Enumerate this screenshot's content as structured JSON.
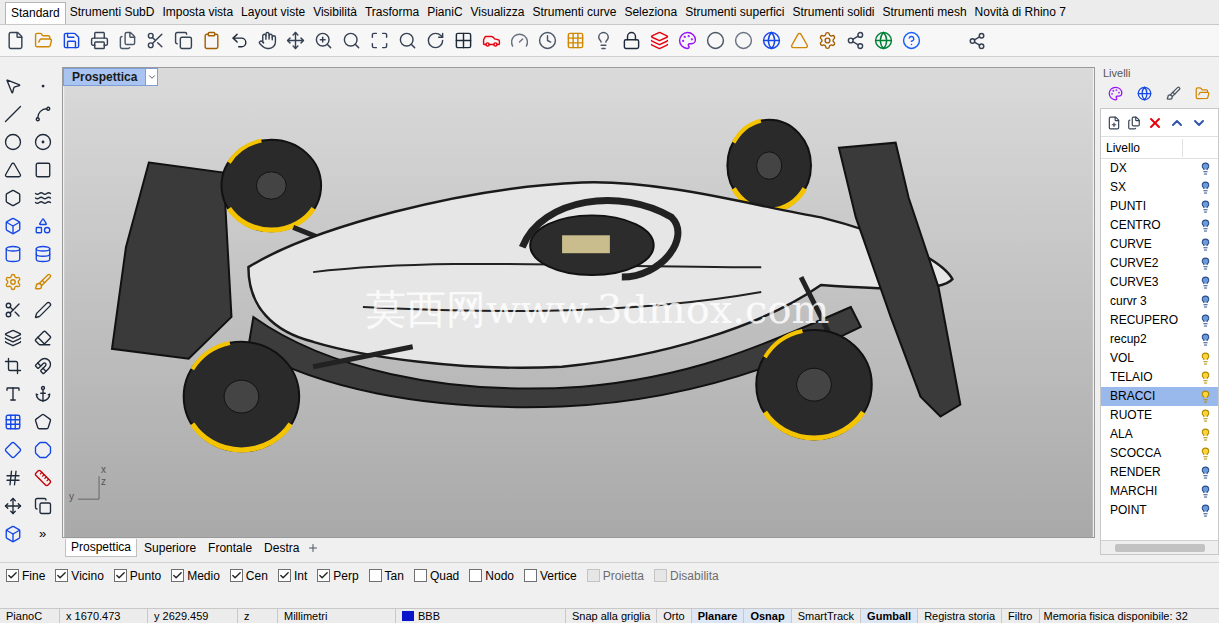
{
  "menu_tabs": [
    {
      "label": "Standard",
      "selected": true
    },
    {
      "label": "Strumenti SubD",
      "selected": false
    },
    {
      "label": "Imposta vista",
      "selected": false
    },
    {
      "label": "Layout viste",
      "selected": false
    },
    {
      "label": "Visibilità",
      "selected": false
    },
    {
      "label": "Trasforma",
      "selected": false
    },
    {
      "label": "PianiC",
      "selected": false
    },
    {
      "label": "Visualizza",
      "selected": false
    },
    {
      "label": "Strumenti curve",
      "selected": false
    },
    {
      "label": "Seleziona",
      "selected": false
    },
    {
      "label": "Strumenti superfici",
      "selected": false
    },
    {
      "label": "Strumenti solidi",
      "selected": false
    },
    {
      "label": "Strumenti mesh",
      "selected": false
    },
    {
      "label": "Novità di Rhino 7",
      "selected": false
    }
  ],
  "left_toolbar": {
    "more": "»"
  },
  "viewport": {
    "title": "Prospettica",
    "watermark": "莫西网www.3dmox.com",
    "axes": {
      "x": "x",
      "z": "z",
      "y": "y"
    }
  },
  "viewport_tabs": [
    {
      "label": "Prospettica",
      "selected": true
    },
    {
      "label": "Superiore",
      "selected": false
    },
    {
      "label": "Frontale",
      "selected": false
    },
    {
      "label": "Destra",
      "selected": false
    }
  ],
  "osnap": [
    {
      "label": "Fine",
      "checked": true,
      "disabled": false
    },
    {
      "label": "Vicino",
      "checked": true,
      "disabled": false
    },
    {
      "label": "Punto",
      "checked": true,
      "disabled": false
    },
    {
      "label": "Medio",
      "checked": true,
      "disabled": false
    },
    {
      "label": "Cen",
      "checked": true,
      "disabled": false
    },
    {
      "label": "Int",
      "checked": true,
      "disabled": false
    },
    {
      "label": "Perp",
      "checked": true,
      "disabled": false
    },
    {
      "label": "Tan",
      "checked": false,
      "disabled": false
    },
    {
      "label": "Quad",
      "checked": false,
      "disabled": false
    },
    {
      "label": "Nodo",
      "checked": false,
      "disabled": false
    },
    {
      "label": "Vertice",
      "checked": false,
      "disabled": false
    },
    {
      "label": "Proietta",
      "checked": false,
      "disabled": true
    },
    {
      "label": "Disabilita",
      "checked": false,
      "disabled": true
    }
  ],
  "layers_panel": {
    "title": "Livelli",
    "column": "Livello",
    "layers": [
      {
        "name": "DX",
        "on": false,
        "selected": false
      },
      {
        "name": "SX",
        "on": false,
        "selected": false
      },
      {
        "name": "PUNTI",
        "on": false,
        "selected": false
      },
      {
        "name": "CENTRO",
        "on": false,
        "selected": false
      },
      {
        "name": "CURVE",
        "on": false,
        "selected": false
      },
      {
        "name": "CURVE2",
        "on": false,
        "selected": false
      },
      {
        "name": "CURVE3",
        "on": false,
        "selected": false
      },
      {
        "name": "curvr 3",
        "on": false,
        "selected": false
      },
      {
        "name": "RECUPERO",
        "on": false,
        "selected": false
      },
      {
        "name": "recup2",
        "on": false,
        "selected": false
      },
      {
        "name": "VOL",
        "on": true,
        "selected": false
      },
      {
        "name": "TELAIO",
        "on": true,
        "selected": false
      },
      {
        "name": "BRACCI",
        "on": true,
        "selected": true
      },
      {
        "name": "RUOTE",
        "on": true,
        "selected": false
      },
      {
        "name": "ALA",
        "on": true,
        "selected": false
      },
      {
        "name": "SCOCCA",
        "on": true,
        "selected": false
      },
      {
        "name": "RENDER",
        "on": false,
        "selected": false
      },
      {
        "name": "MARCHI",
        "on": false,
        "selected": false
      },
      {
        "name": "POINT",
        "on": false,
        "selected": false
      }
    ]
  },
  "status_bar": {
    "plane": "PianoC",
    "x": "x 1670.473",
    "y": "y 2629.459",
    "z": "z",
    "units": "Millimetri",
    "layer": {
      "name": "BBB",
      "color": "#0a14c8"
    },
    "toggles": [
      {
        "label": "Snap alla griglia",
        "active": false
      },
      {
        "label": "Orto",
        "active": false
      },
      {
        "label": "Planare",
        "active": true
      },
      {
        "label": "Osnap",
        "active": true
      },
      {
        "label": "SmartTrack",
        "active": false
      },
      {
        "label": "Gumball",
        "active": true
      },
      {
        "label": "Registra storia",
        "active": false
      },
      {
        "label": "Filtro",
        "active": false
      }
    ],
    "memory": "Memoria fisica disponibile: 32"
  }
}
